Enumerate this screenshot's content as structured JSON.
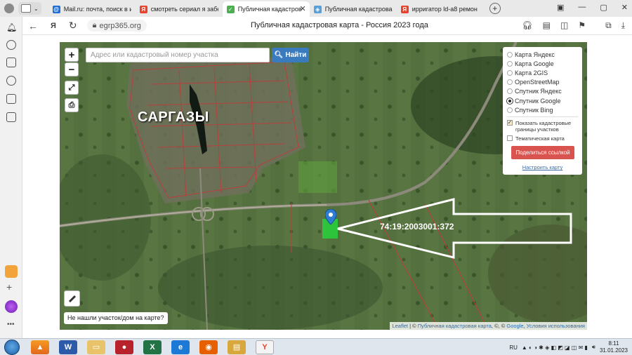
{
  "tabs": [
    {
      "title": "Mail.ru: почта, поиск в и",
      "fav_color": "#1f6fd6",
      "fav_glyph": "@",
      "icon": "mail-icon"
    },
    {
      "title": "смотреть сериал я забе",
      "fav_color": "#e8412c",
      "fav_glyph": "Я",
      "icon": "yandex-icon"
    },
    {
      "title": "Публичная кадастров",
      "fav_color": "#4caf50",
      "fav_glyph": "✓",
      "icon": "check-icon",
      "active": true
    },
    {
      "title": "Публичная кадастрова",
      "fav_color": "#5aa0d8",
      "fav_glyph": "◈",
      "icon": "map-icon"
    },
    {
      "title": "ирригатор ld-a8 ремон",
      "fav_color": "#e8412c",
      "fav_glyph": "Я",
      "icon": "yandex-icon"
    }
  ],
  "address": {
    "domain": "egrp365.org",
    "page_title": "Публичная кадастровая карта - Россия 2023 года"
  },
  "map": {
    "search_placeholder": "Адрес или кадастровый номер участка",
    "find_label": "Найти",
    "zoom_in": "+",
    "zoom_out": "−",
    "place_label": "САРГАЗЫ",
    "cadastral_number": "74:19:2003001:372",
    "not_found_label": "Не нашли участок/дом на карте?",
    "attribution": {
      "leaflet": "Leaflet",
      "sep": " | © ",
      "pkk": "Публичная кадастровая карта",
      "mid": ", ©, © ",
      "google": "Google",
      "comma": ", ",
      "terms": "Условия использования"
    }
  },
  "layers": {
    "options": [
      {
        "label": "Карта Яндекс",
        "selected": false
      },
      {
        "label": "Карта Google",
        "selected": false
      },
      {
        "label": "Карта 2GIS",
        "selected": false
      },
      {
        "label": "OpenStreetMap",
        "selected": false
      },
      {
        "label": "Спутник Яндекс",
        "selected": false
      },
      {
        "label": "Спутник Google",
        "selected": true
      },
      {
        "label": "Спутник Bing",
        "selected": false
      }
    ],
    "checkboxes": [
      {
        "label": "Показать кадастровые границы участков",
        "checked": true
      },
      {
        "label": "Тематическая карта",
        "checked": false
      }
    ],
    "share_label": "Поделиться ссылкой",
    "configure_label": "Настроить карту"
  },
  "taskbar": {
    "lang": "RU",
    "time": "8:11",
    "date": "31.01.2023"
  }
}
